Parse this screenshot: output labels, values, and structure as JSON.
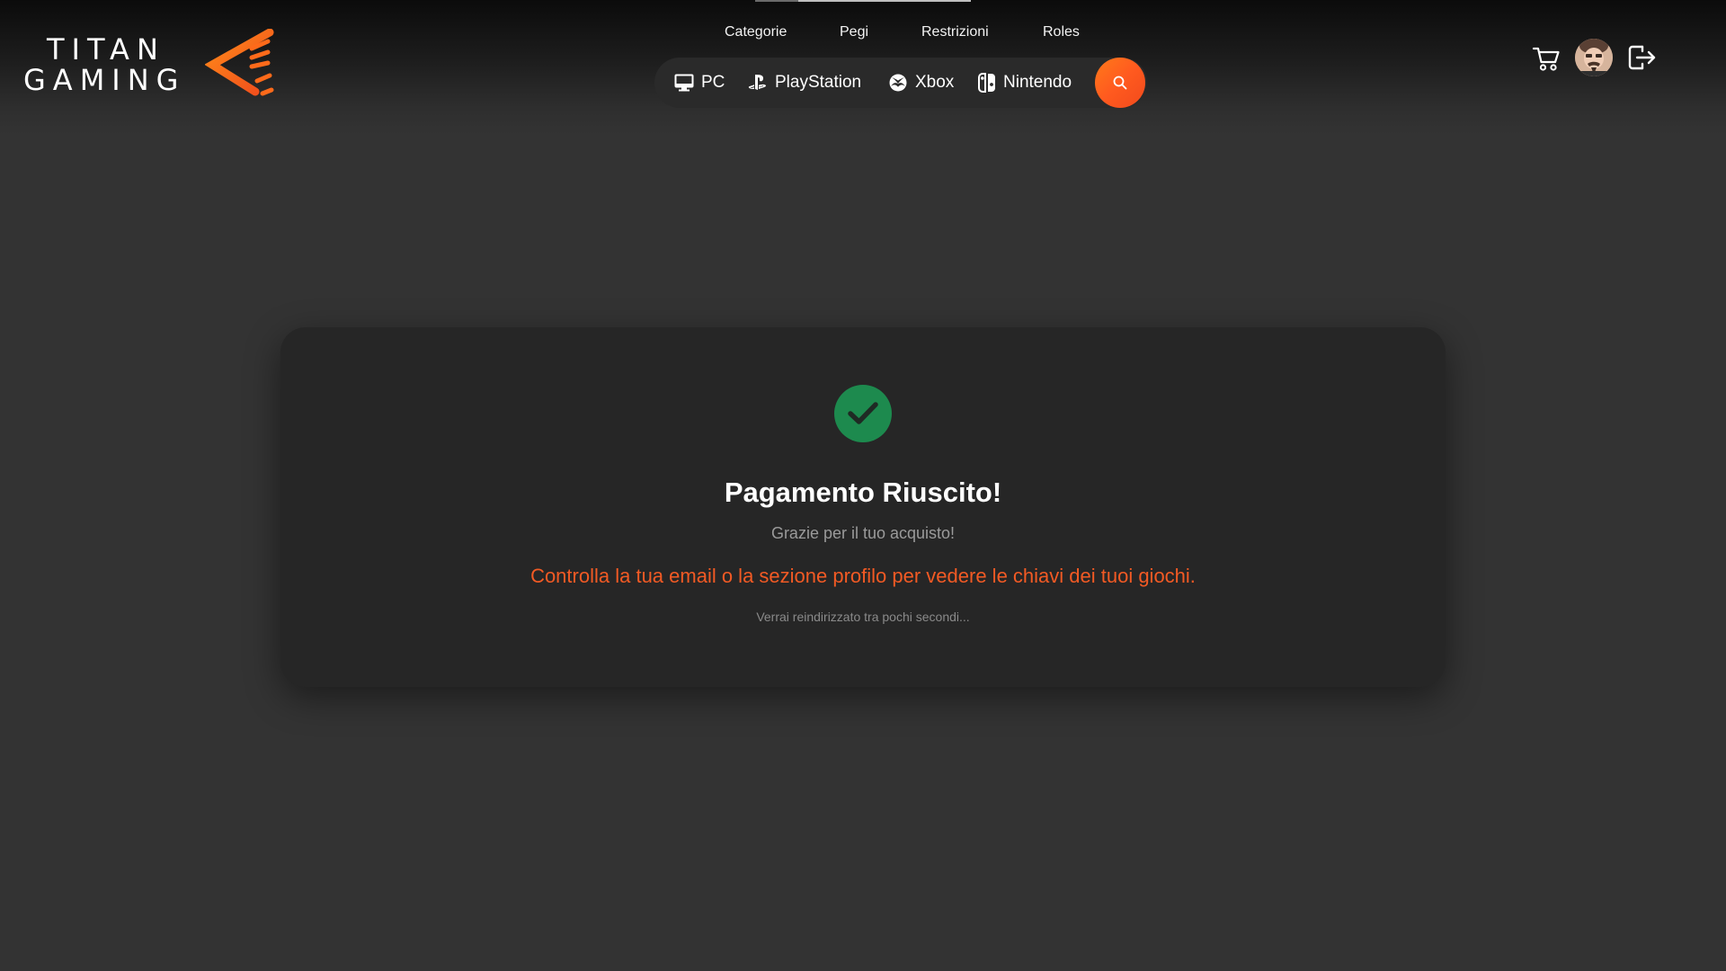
{
  "brand": {
    "line1": "TITAN",
    "line2": "GAMING",
    "accent_color": "#ff5a1f"
  },
  "category_nav": {
    "items": [
      {
        "label": "Categorie"
      },
      {
        "label": "Pegi"
      },
      {
        "label": "Restrizioni"
      },
      {
        "label": "Roles"
      }
    ]
  },
  "platforms": {
    "items": [
      {
        "label": "PC",
        "icon": "monitor-icon"
      },
      {
        "label": "PlayStation",
        "icon": "playstation-icon"
      },
      {
        "label": "Xbox",
        "icon": "xbox-icon"
      },
      {
        "label": "Nintendo",
        "icon": "nintendo-switch-icon"
      }
    ],
    "search_icon": "search-icon"
  },
  "user_actions": {
    "cart_icon": "cart-icon",
    "avatar_icon": "avatar",
    "logout_icon": "logout-icon"
  },
  "confirmation": {
    "status_icon": "check-icon",
    "status_color": "#1d8a4e",
    "title": "Pagamento Riuscito!",
    "subtitle": "Grazie per il tuo acquisto!",
    "info": "Controlla la tua email o la sezione profilo per vedere le chiavi dei tuoi giochi.",
    "redirect": "Verrai reindirizzato tra pochi secondi..."
  }
}
